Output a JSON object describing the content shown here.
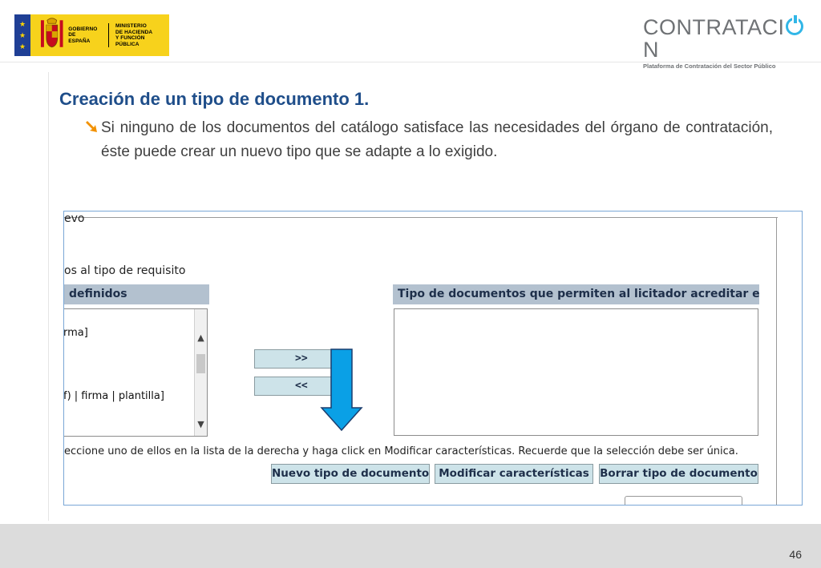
{
  "header": {
    "gov_logo_line1": "GOBIERNO",
    "gov_logo_line2": "DE ESPAÑA",
    "ministry_line1": "MINISTERIO",
    "ministry_line2": "DE HACIENDA",
    "ministry_line3": "Y FUNCIÓN PÚBLICA",
    "brand_left": "CONTRATACI",
    "brand_right": "N",
    "brand_subtitle": "Plataforma de Contratación del Sector Público",
    "brand_color": "#31b6e7"
  },
  "slide": {
    "title": "Creación de un tipo de documento 1.",
    "bullet_text": "Si ninguno de los documentos del catálogo satisface las necesidades del órgano de contratación, éste puede crear un nuevo tipo que se adapte a lo exigido.",
    "title_color": "#1f4e8a"
  },
  "screenshot": {
    "top_label": "evo",
    "requirement_label": "os al tipo de requisito",
    "left_header": "definidos",
    "right_header": "Tipo de documentos que permiten al licitador acreditar el cumplimiento",
    "left_list": [
      "rma]",
      "f) | firma | plantilla]"
    ],
    "move_right_label": ">>",
    "move_left_label": "<<",
    "instruction": "eccione uno de ellos en la lista de la derecha y haga click en Modificar características. Recuerde que la selección debe ser única.",
    "buttons": {
      "new_type": "Nuevo tipo de documento",
      "modify": "Modificar características",
      "delete": "Borrar tipo de documento"
    },
    "arrow_color": "#0aa0e6"
  },
  "footer": {
    "page_number": "46"
  }
}
